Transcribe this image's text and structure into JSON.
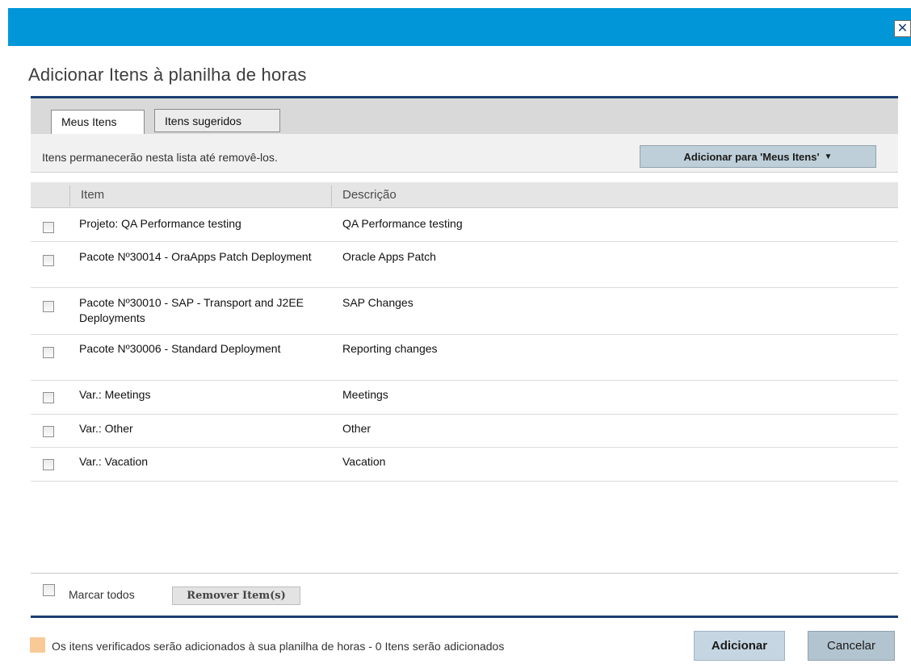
{
  "dialog": {
    "close_symbol": "✕",
    "title": "Adicionar Itens à planilha de horas"
  },
  "tabs": [
    {
      "label": "Meus Itens",
      "active": true
    },
    {
      "label": "Itens sugeridos",
      "active": false
    }
  ],
  "info": {
    "text": "Itens permanecerão nesta lista até removê-los.",
    "add_button_label": "Adicionar para 'Meus Itens'"
  },
  "table": {
    "columns": {
      "item": "Item",
      "description": "Descrição"
    },
    "rows": [
      {
        "item": "Projeto: QA Performance testing",
        "description": "QA Performance testing",
        "checked": false
      },
      {
        "item": "Pacote Nº30014 - OraApps Patch Deployment",
        "description": "Oracle Apps Patch",
        "checked": false
      },
      {
        "item": "Pacote Nº30010 - SAP - Transport and J2EE Deployments",
        "description": "SAP Changes",
        "checked": false
      },
      {
        "item": "Pacote Nº30006 - Standard Deployment",
        "description": "Reporting changes",
        "checked": false
      },
      {
        "item": "Var.: Meetings",
        "description": "Meetings",
        "checked": false
      },
      {
        "item": "Var.: Other",
        "description": "Other",
        "checked": false
      },
      {
        "item": "Var.: Vacation",
        "description": "Vacation",
        "checked": false
      }
    ]
  },
  "footer": {
    "mark_all_label": "Marcar todos",
    "remove_label": "Remover Item(s)",
    "legend_text": "Os itens verificados serão adicionados à sua planilha de horas - 0 Itens serão adicionados",
    "add_label": "Adicionar",
    "cancel_label": "Cancelar"
  },
  "colors": {
    "header_bar": "#0196d7",
    "panel_line": "#1b3f71",
    "legend_swatch": "#f9c997",
    "button_bg": "#c5d6e2"
  }
}
